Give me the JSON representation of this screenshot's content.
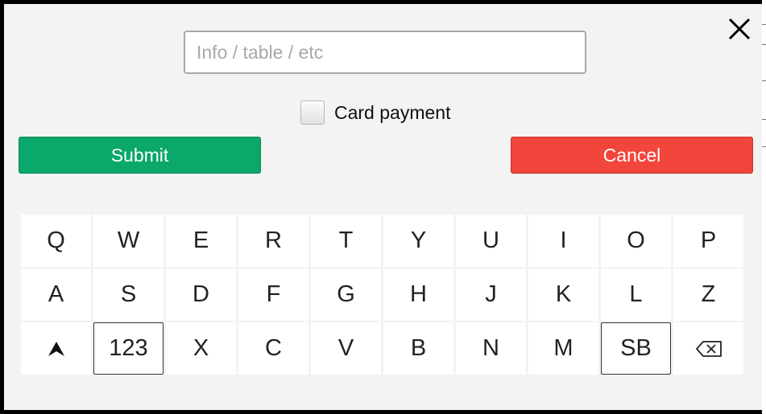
{
  "close_icon": "close-icon",
  "input": {
    "placeholder": "Info / table / etc",
    "value": ""
  },
  "card_payment": {
    "label": "Card payment",
    "checked": false
  },
  "buttons": {
    "submit": {
      "label": "Submit",
      "color": "#0aa86a"
    },
    "cancel": {
      "label": "Cancel",
      "color": "#f2453b"
    }
  },
  "keyboard": {
    "rows": [
      [
        "Q",
        "W",
        "E",
        "R",
        "T",
        "Y",
        "U",
        "I",
        "O",
        "P"
      ],
      [
        "A",
        "S",
        "D",
        "F",
        "G",
        "H",
        "J",
        "K",
        "L",
        "Z"
      ],
      [
        "⇧",
        "123",
        "X",
        "C",
        "V",
        "B",
        "N",
        "M",
        "SB",
        "⌫"
      ]
    ],
    "special_icons": {
      "shift": "shift-arrow-icon",
      "backspace": "backspace-icon"
    }
  }
}
